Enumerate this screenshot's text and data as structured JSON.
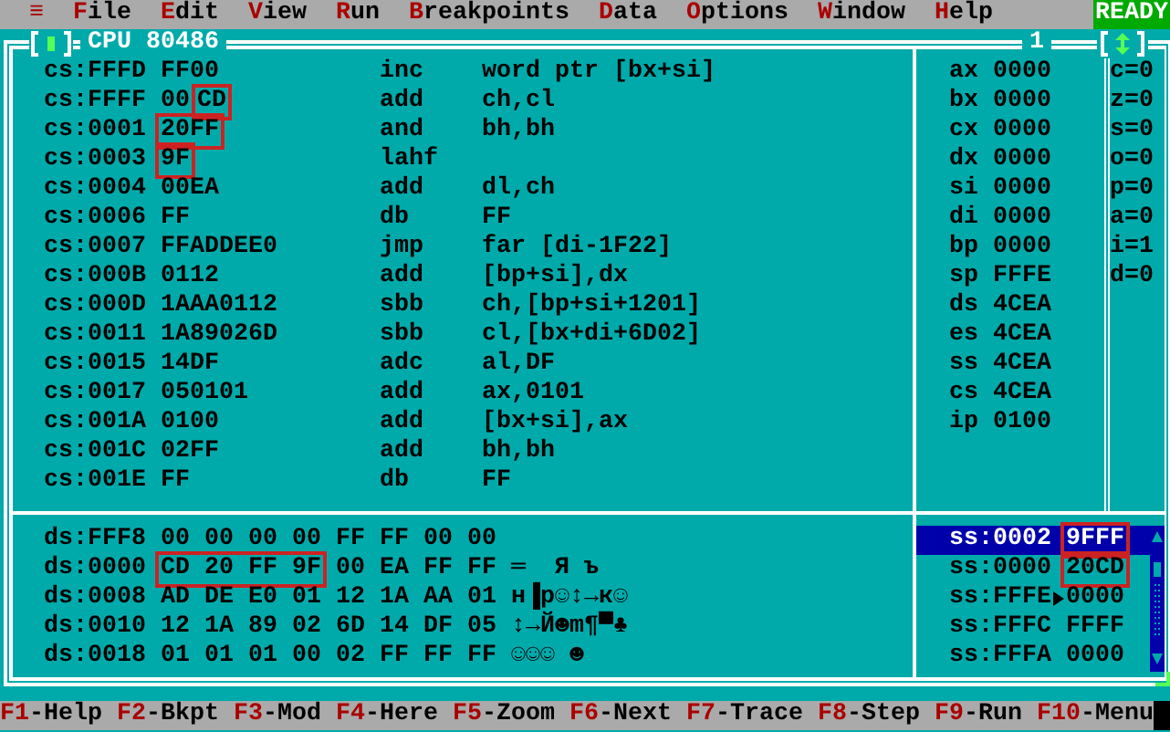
{
  "menu_bar": {
    "items": [
      {
        "label": "≡"
      },
      {
        "label": "File"
      },
      {
        "label": "Edit"
      },
      {
        "label": "View"
      },
      {
        "label": "Run"
      },
      {
        "label": "Breakpoints"
      },
      {
        "label": "Data"
      },
      {
        "label": "Options"
      },
      {
        "label": "Window"
      },
      {
        "label": "Help"
      }
    ],
    "status": "READY"
  },
  "cpu_window": {
    "title": "CPU 80486",
    "number": "1",
    "code": [
      {
        "address": "cs:FFFD",
        "bytes": [
          {
            "text": "FF00",
            "boxed": false
          }
        ],
        "mnemonic": "inc",
        "operands": "word ptr [bx+si]"
      },
      {
        "address": "cs:FFFF",
        "bytes": [
          {
            "text": "00",
            "boxed": false
          },
          {
            "text": "CD",
            "boxed": true
          }
        ],
        "mnemonic": "add",
        "operands": "ch,cl"
      },
      {
        "address": "cs:0001",
        "bytes": [
          {
            "text": "20FF",
            "boxed": true
          }
        ],
        "mnemonic": "and",
        "operands": "bh,bh"
      },
      {
        "address": "cs:0003",
        "bytes": [
          {
            "text": "9F",
            "boxed": true
          }
        ],
        "mnemonic": "lahf"
      },
      {
        "address": "cs:0004",
        "bytes": [
          {
            "text": "00EA",
            "boxed": false
          }
        ],
        "mnemonic": "add",
        "operands": "dl,ch"
      },
      {
        "address": "cs:0006",
        "bytes": [
          {
            "text": "FF",
            "boxed": false
          }
        ],
        "mnemonic": "db",
        "operands": "FF"
      },
      {
        "address": "cs:0007",
        "bytes": [
          {
            "text": "FFADDEE0",
            "boxed": false
          }
        ],
        "mnemonic": "jmp",
        "operands": "far [di-1F22]"
      },
      {
        "address": "cs:000B",
        "bytes": [
          {
            "text": "0112",
            "boxed": false
          }
        ],
        "mnemonic": "add",
        "operands": "[bp+si],dx"
      },
      {
        "address": "cs:000D",
        "bytes": [
          {
            "text": "1AAA0112",
            "boxed": false
          }
        ],
        "mnemonic": "sbb",
        "operands": "ch,[bp+si+1201]"
      },
      {
        "address": "cs:0011",
        "bytes": [
          {
            "text": "1A89026D",
            "boxed": false
          }
        ],
        "mnemonic": "sbb",
        "operands": "cl,[bx+di+6D02]"
      },
      {
        "address": "cs:0015",
        "bytes": [
          {
            "text": "14DF",
            "boxed": false
          }
        ],
        "mnemonic": "adc",
        "operands": "al,DF"
      },
      {
        "address": "cs:0017",
        "bytes": [
          {
            "text": "050101",
            "boxed": false
          }
        ],
        "mnemonic": "add",
        "operands": "ax,0101"
      },
      {
        "address": "cs:001A",
        "bytes": [
          {
            "text": "0100",
            "boxed": false
          }
        ],
        "mnemonic": "add",
        "operands": "[bx+si],ax"
      },
      {
        "address": "cs:001C",
        "bytes": [
          {
            "text": "02FF",
            "boxed": false
          }
        ],
        "mnemonic": "add",
        "operands": "bh,bh"
      },
      {
        "address": "cs:001E",
        "bytes": [
          {
            "text": "FF",
            "boxed": false
          }
        ],
        "mnemonic": "db",
        "operands": "FF"
      }
    ],
    "registers": [
      {
        "name": "ax",
        "value": "0000"
      },
      {
        "name": "bx",
        "value": "0000"
      },
      {
        "name": "cx",
        "value": "0000"
      },
      {
        "name": "dx",
        "value": "0000"
      },
      {
        "name": "si",
        "value": "0000"
      },
      {
        "name": "di",
        "value": "0000"
      },
      {
        "name": "bp",
        "value": "0000"
      },
      {
        "name": "sp",
        "value": "FFFE"
      },
      {
        "name": "ds",
        "value": "4CEA"
      },
      {
        "name": "es",
        "value": "4CEA"
      },
      {
        "name": "ss",
        "value": "4CEA"
      },
      {
        "name": "cs",
        "value": "4CEA"
      },
      {
        "name": "ip",
        "value": "0100"
      }
    ],
    "flags": [
      "c=0",
      "z=0",
      "s=0",
      "o=0",
      "p=0",
      "a=0",
      "i=1",
      "d=0"
    ],
    "dump": [
      {
        "address": "ds:FFF8",
        "bytes": [
          {
            "text": "00 00 00 00 FF FF 00 00",
            "boxed": false
          }
        ]
      },
      {
        "address": "ds:0000",
        "bytes": [
          {
            "text": "CD 20 FF 9F",
            "boxed": true
          },
          {
            "text": "00 EA FF FF",
            "boxed": false
          }
        ],
        "chars": "═  Я ъ"
      },
      {
        "address": "ds:0008",
        "bytes": [
          {
            "text": "AD DE E0 01 12 1A AA 01",
            "boxed": false
          }
        ],
        "chars": "н▐р☺↕→к☺"
      },
      {
        "address": "ds:0010",
        "bytes": [
          {
            "text": "12 1A 89 02 6D 14 DF 05",
            "boxed": false
          }
        ],
        "chars": "↕→Й☻m¶▀♣"
      },
      {
        "address": "ds:0018",
        "bytes": [
          {
            "text": "01 01 01 00 02 FF FF FF",
            "boxed": false
          }
        ],
        "chars": "☺☺☺ ☻"
      }
    ],
    "stack": [
      {
        "address": "ss:0002",
        "value": "9FFF",
        "selected": true,
        "boxed": true,
        "pointer": false
      },
      {
        "address": "ss:0000",
        "value": "20CD",
        "selected": false,
        "boxed": true,
        "pointer": false
      },
      {
        "address": "ss:FFFE",
        "value": "0000",
        "selected": false,
        "boxed": false,
        "pointer": true
      },
      {
        "address": "ss:FFFC",
        "value": "FFFF",
        "selected": false,
        "boxed": false,
        "pointer": false
      },
      {
        "address": "ss:FFFA",
        "value": "0000",
        "selected": false,
        "boxed": false,
        "pointer": false
      }
    ]
  },
  "function_keys": [
    {
      "key": "F1",
      "label": "-Help"
    },
    {
      "key": "F2",
      "label": "-Bkpt"
    },
    {
      "key": "F3",
      "label": "-Mod"
    },
    {
      "key": "F4",
      "label": "-Here"
    },
    {
      "key": "F5",
      "label": "-Zoom"
    },
    {
      "key": "F6",
      "label": "-Next"
    },
    {
      "key": "F7",
      "label": "-Trace"
    },
    {
      "key": "F8",
      "label": "-Step"
    },
    {
      "key": "F9",
      "label": "-Run"
    },
    {
      "key": "F10",
      "label": "-Menu"
    }
  ]
}
